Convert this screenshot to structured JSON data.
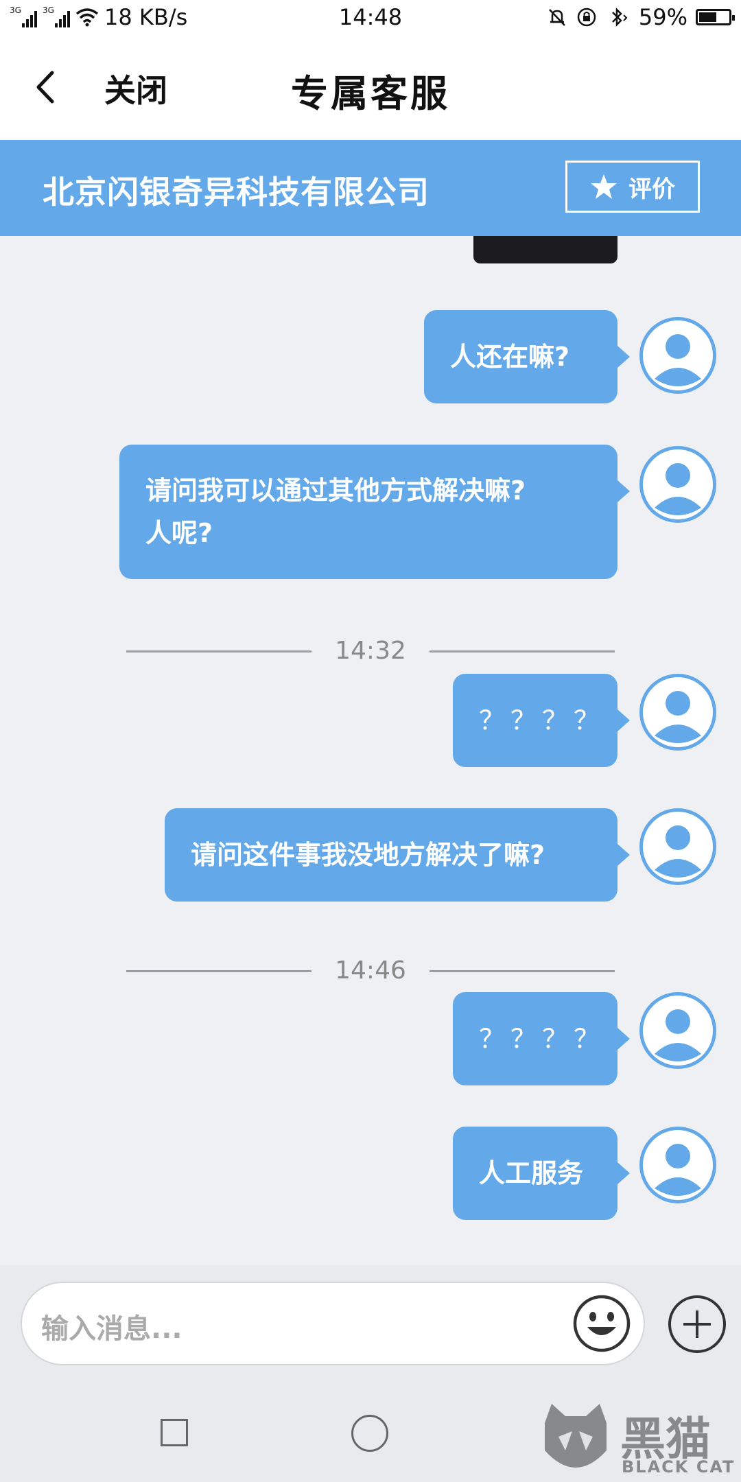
{
  "status_bar": {
    "network_left": "3G",
    "network_right": "3G",
    "speed": "18 KB/s",
    "time": "14:48",
    "battery_percent": "59%",
    "battery_level": 0.59
  },
  "header": {
    "close_label": "关闭",
    "title": "专属客服"
  },
  "company_bar": {
    "name": "北京闪银奇异科技有限公司",
    "rate_label": "评价"
  },
  "messages": [
    {
      "text": "人还在嘛?"
    },
    {
      "lines": [
        "请问我可以通过其他方式解决嘛?",
        "人呢?"
      ]
    },
    {
      "time": "14:32"
    },
    {
      "text": "？？？？"
    },
    {
      "text": "请问这件事我没地方解决了嘛?"
    },
    {
      "time": "14:46"
    },
    {
      "text": "？？？？"
    },
    {
      "text": "人工服务"
    }
  ],
  "input": {
    "placeholder": "输入消息..."
  },
  "watermark": {
    "cn": "黑猫",
    "en": "BLACK CAT"
  },
  "colors": {
    "accent": "#63a9e9",
    "background": "#eef0f3"
  }
}
